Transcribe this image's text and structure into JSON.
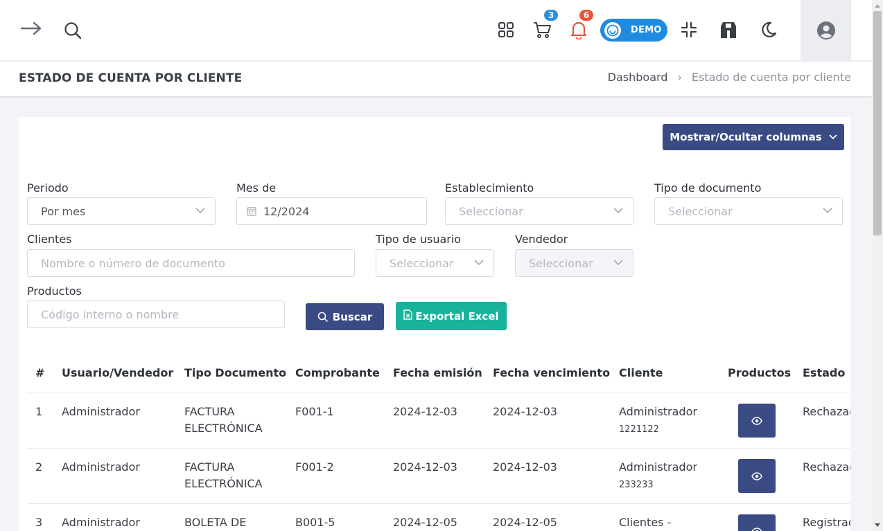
{
  "topbar": {
    "cart_count": "3",
    "notification_count": "6",
    "demo_label": "DEMO"
  },
  "header": {
    "title": "ESTADO DE CUENTA POR CLIENTE",
    "breadcrumb_home": "Dashboard",
    "breadcrumb_sep": "›",
    "breadcrumb_current": "Estado de cuenta por cliente"
  },
  "toolbar": {
    "columns_button": "Mostrar/Ocultar columnas"
  },
  "filters": {
    "periodo_label": "Periodo",
    "periodo_value": "Por mes",
    "mes_label": "Mes de",
    "mes_value": "12/2024",
    "establecimiento_label": "Establecimiento",
    "establecimiento_ph": "Seleccionar",
    "tipo_doc_label": "Tipo de documento",
    "tipo_doc_ph": "Seleccionar",
    "clientes_label": "Clientes",
    "clientes_ph": "Nombre o número de documento",
    "tipo_usuario_label": "Tipo de usuario",
    "tipo_usuario_ph": "Seleccionar",
    "vendedor_label": "Vendedor",
    "vendedor_ph": "Seleccionar",
    "productos_label": "Productos",
    "productos_ph": "Código interno o nombre",
    "search_button": "Buscar",
    "excel_button": "Exportal Excel"
  },
  "table": {
    "headers": [
      "#",
      "Usuario/Vendedor",
      "Tipo Documento",
      "Comprobante",
      "Fecha emisión",
      "Fecha vencimiento",
      "Cliente",
      "Productos",
      "Estado"
    ],
    "rows": [
      {
        "num": "1",
        "user": "Administrador",
        "doc_type_1": "FACTURA",
        "doc_type_2": "ELECTRÓNICA",
        "voucher": "F001-1",
        "issued": "2024-12-03",
        "due": "2024-12-03",
        "client": "Administrador",
        "client_doc": "1221122",
        "status": "Rechazado"
      },
      {
        "num": "2",
        "user": "Administrador",
        "doc_type_1": "FACTURA",
        "doc_type_2": "ELECTRÓNICA",
        "voucher": "F001-2",
        "issued": "2024-12-03",
        "due": "2024-12-03",
        "client": "Administrador",
        "client_doc": "233233",
        "status": "Rechazado"
      },
      {
        "num": "3",
        "user": "Administrador",
        "doc_type_1": "BOLETA DE",
        "doc_type_2": "",
        "voucher": "B001-5",
        "issued": "2024-12-05",
        "due": "2024-12-05",
        "client": "Clientes -",
        "client_doc": "",
        "status": "Registrado"
      }
    ]
  }
}
